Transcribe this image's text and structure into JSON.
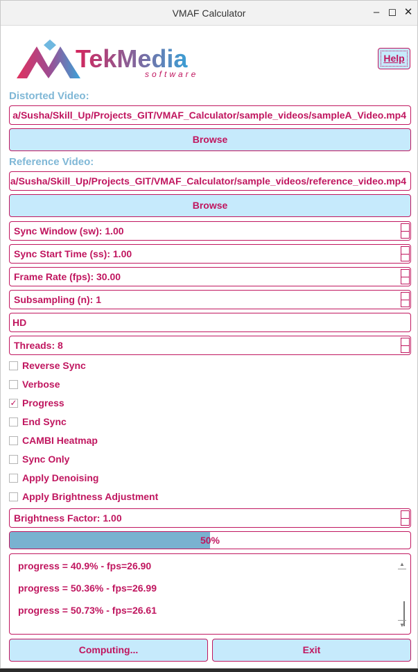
{
  "window": {
    "title": "VMAF Calculator"
  },
  "logo": {
    "brand": "TekMedia",
    "tagline": "software"
  },
  "help_label": "Help",
  "distorted": {
    "label": "Distorted Video:",
    "path": "a/Susha/Skill_Up/Projects_GIT/VMAF_Calculator/sample_videos/sampleA_Video.mp4",
    "browse_label": "Browse"
  },
  "reference": {
    "label": "Reference Video:",
    "path": "a/Susha/Skill_Up/Projects_GIT/VMAF_Calculator/sample_videos/reference_video.mp4",
    "browse_label": "Browse"
  },
  "params": {
    "sync_window": "Sync Window (sw): 1.00",
    "sync_start": "Sync Start Time (ss): 1.00",
    "frame_rate": "Frame Rate (fps): 30.00",
    "subsampling": "Subsampling (n): 1",
    "model": "HD",
    "threads": "Threads: 8"
  },
  "options": [
    {
      "label": "Reverse Sync",
      "checked": false
    },
    {
      "label": "Verbose",
      "checked": false
    },
    {
      "label": "Progress",
      "checked": true
    },
    {
      "label": "End Sync",
      "checked": false
    },
    {
      "label": "CAMBI Heatmap",
      "checked": false
    },
    {
      "label": "Sync Only",
      "checked": false
    },
    {
      "label": "Apply Denoising",
      "checked": false
    },
    {
      "label": "Apply Brightness Adjustment",
      "checked": false
    }
  ],
  "brightness_factor": "Brightness Factor: 1.00",
  "progress": {
    "value": 0.5,
    "text": "50%"
  },
  "log": {
    "lines": [
      "progress = 40.9% -  fps=26.90",
      "progress = 50.36% -  fps=26.99",
      "progress = 50.73% -  fps=26.61"
    ]
  },
  "actions": {
    "compute_label": "Computing...",
    "exit_label": "Exit"
  },
  "colors": {
    "accent": "#c0165f",
    "button_bg": "#c6eafc",
    "label_blue": "#7fb7d6",
    "progress_fill": "#79b2d0"
  }
}
